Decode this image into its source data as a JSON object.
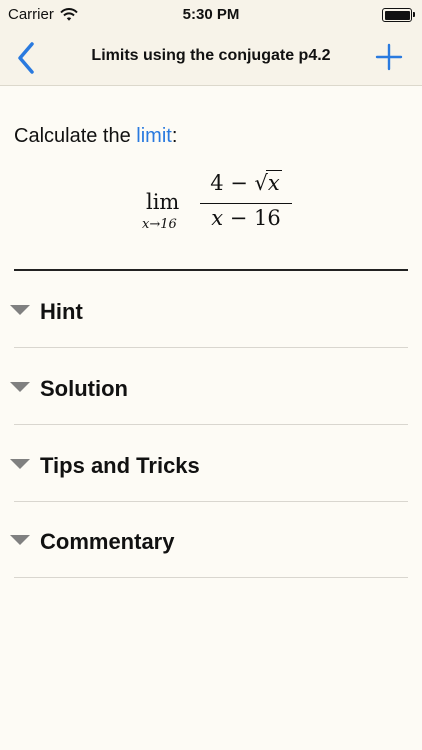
{
  "status_bar": {
    "carrier": "Carrier",
    "time": "5:30 PM"
  },
  "nav": {
    "title": "Limits using the conjugate p4.2",
    "back_icon": "chevron-left-icon",
    "add_icon": "plus-icon",
    "accent_color": "#2a7adf"
  },
  "problem": {
    "prompt_prefix": "Calculate the ",
    "prompt_link": "limit",
    "prompt_suffix": ":",
    "formula": {
      "lim": "lim",
      "subscript": "x→16",
      "numerator_const": "4 − ",
      "sqrt_symbol": "√",
      "numerator_var": "x",
      "denominator_var": "x",
      "denominator_rest": " − 16"
    }
  },
  "sections": [
    {
      "label": "Hint"
    },
    {
      "label": "Solution"
    },
    {
      "label": "Tips and Tricks"
    },
    {
      "label": "Commentary"
    }
  ]
}
